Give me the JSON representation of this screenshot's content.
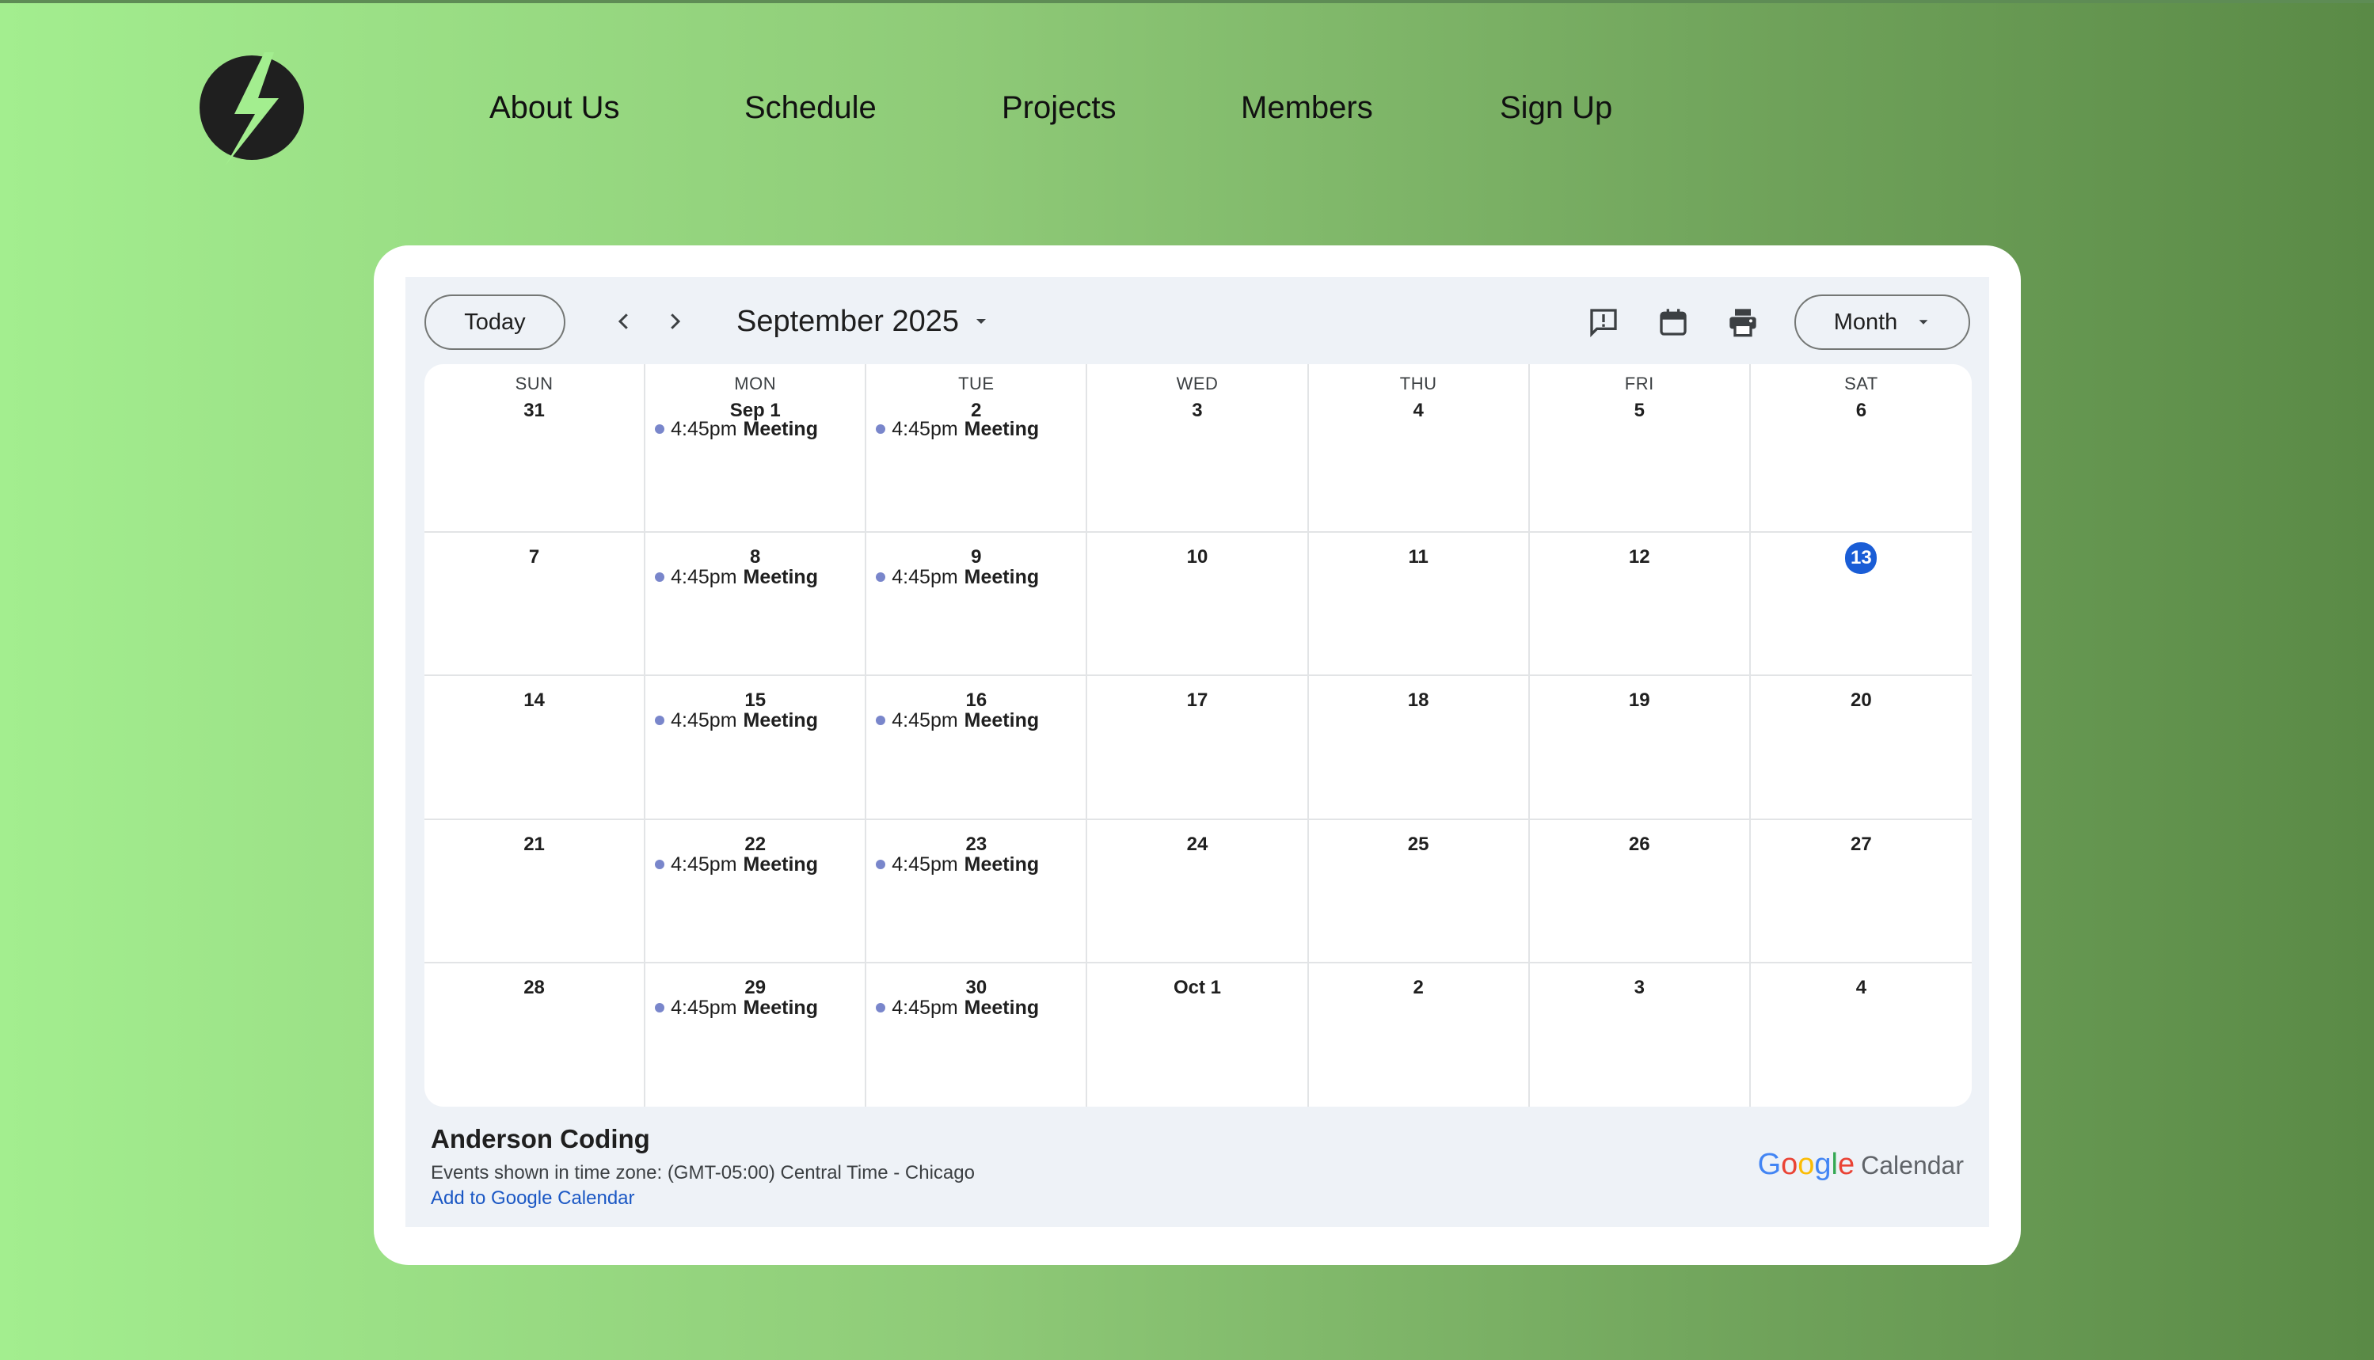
{
  "nav": {
    "logo_icon": "lightning-bolt-logo-icon",
    "items": [
      "About Us",
      "Schedule",
      "Projects",
      "Members",
      "Sign Up"
    ]
  },
  "calendar": {
    "today_label": "Today",
    "prev_icon": "chevron-left-icon",
    "next_icon": "chevron-right-icon",
    "month_title": "September 2025",
    "view_label": "Month",
    "toolbar_icons": [
      "feedback-icon",
      "calendar-icon",
      "print-icon"
    ],
    "weekdays": [
      "SUN",
      "MON",
      "TUE",
      "WED",
      "THU",
      "FRI",
      "SAT"
    ],
    "today_date": "13",
    "weeks": [
      [
        "31",
        "Sep 1",
        "2",
        "3",
        "4",
        "5",
        "6"
      ],
      [
        "7",
        "8",
        "9",
        "10",
        "11",
        "12",
        "13"
      ],
      [
        "14",
        "15",
        "16",
        "17",
        "18",
        "19",
        "20"
      ],
      [
        "21",
        "22",
        "23",
        "24",
        "25",
        "26",
        "27"
      ],
      [
        "28",
        "29",
        "30",
        "Oct 1",
        "2",
        "3",
        "4"
      ]
    ],
    "event": {
      "time": "4:45pm",
      "title": "Meeting",
      "dot_color": "#7986cb"
    },
    "event_days": [
      "Sep 1",
      "2",
      "8",
      "9",
      "15",
      "16",
      "22",
      "23",
      "29",
      "30"
    ],
    "footer": {
      "calendar_name": "Anderson Coding",
      "timezone_text": "Events shown in time zone: (GMT-05:00) Central Time - Chicago",
      "add_link": "Add to Google Calendar",
      "brand_google": "Google",
      "brand_calendar": "Calendar"
    }
  },
  "colors": {
    "accent_today": "#1a5dd6",
    "link": "#1a57c4",
    "background_gradient_start": "#a3ee8f",
    "background_gradient_end": "#5a8a46"
  }
}
